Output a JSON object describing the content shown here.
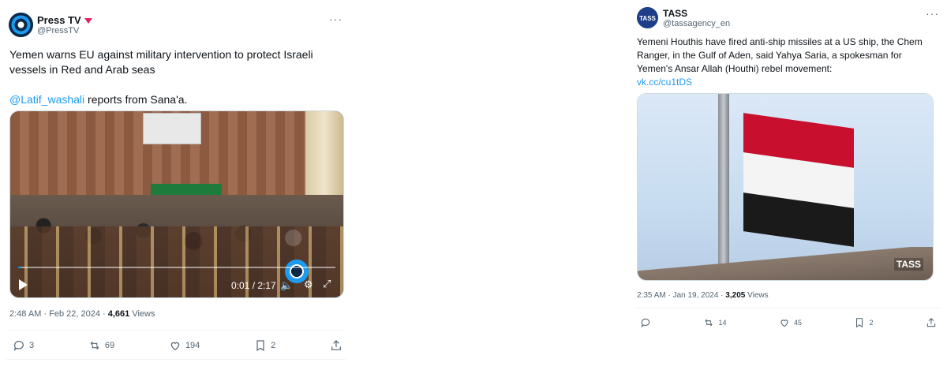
{
  "tweets": [
    {
      "author": {
        "name": "Press TV",
        "handle": "@PressTV"
      },
      "text_line1": "Yemen warns EU against military intervention to protect Israeli vessels in Red and Arab seas",
      "mention": "@Latif_washali",
      "text_after_mention": " reports from Sana'a.",
      "video": {
        "time": "0:01 / 2:17",
        "progress": 0.007
      },
      "timestamp": "2:48 AM · Feb 22, 2024 · ",
      "views_count": "4,661",
      "views_label": " Views",
      "actions": {
        "replies": "3",
        "reposts": "69",
        "likes": "194",
        "bookmarks": "2"
      }
    },
    {
      "author": {
        "name": "TASS",
        "handle": "@tassagency_en"
      },
      "text": "Yemeni Houthis have fired anti-ship missiles at a US ship, the Chem Ranger, in the Gulf of Aden, said Yahya Saria, a spokesman for Yemen's Ansar Allah (Houthi) rebel movement:",
      "link": "vk.cc/cu1tDS",
      "image_watermark": "TASS",
      "timestamp": "2:35 AM · Jan 19, 2024 · ",
      "views_count": "3,205",
      "views_label": " Views",
      "actions": {
        "reposts": "14",
        "likes": "45",
        "bookmarks": "2"
      }
    }
  ],
  "icons": {
    "reply": "reply-icon",
    "repost": "repost-icon",
    "like": "heart-icon",
    "bookmark": "bookmark-icon",
    "share": "share-icon",
    "more": "more-icon"
  },
  "colors": {
    "link": "#1d9bf0",
    "muted": "#536471",
    "text": "#0f1419",
    "verified": "#e0245e"
  }
}
